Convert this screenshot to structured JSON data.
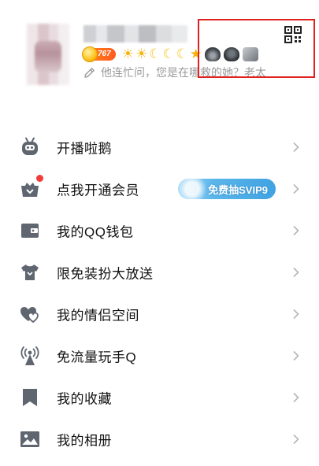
{
  "profile": {
    "vip_level": "767",
    "level_icons": [
      "☀",
      "☀",
      "☾",
      "☾",
      "☾",
      "★"
    ],
    "signature": "他连忙问，您是在哪救的她？老太"
  },
  "menu": {
    "items": [
      {
        "label": "开播啦鹅",
        "icon": "robot-tv-icon"
      },
      {
        "label": "点我开通会员",
        "icon": "vip-crown-basket-icon",
        "badge": "red-dot",
        "promo": "免费抽SVIP9"
      },
      {
        "label": "我的QQ钱包",
        "icon": "wallet-icon"
      },
      {
        "label": "限免装扮大放送",
        "icon": "tshirt-icon"
      },
      {
        "label": "我的情侣空间",
        "icon": "hearts-icon"
      },
      {
        "label": "免流量玩手Q",
        "icon": "signal-tower-icon"
      },
      {
        "label": "我的收藏",
        "icon": "bookmark-icon"
      },
      {
        "label": "我的相册",
        "icon": "photo-icon"
      }
    ]
  },
  "colors": {
    "icon": "#5f6670",
    "label": "#111111",
    "chevron": "#b5b5b5",
    "highlight": "#e0221e",
    "vip_badge": "#ff6a1e",
    "promo": "#4aaee6"
  }
}
